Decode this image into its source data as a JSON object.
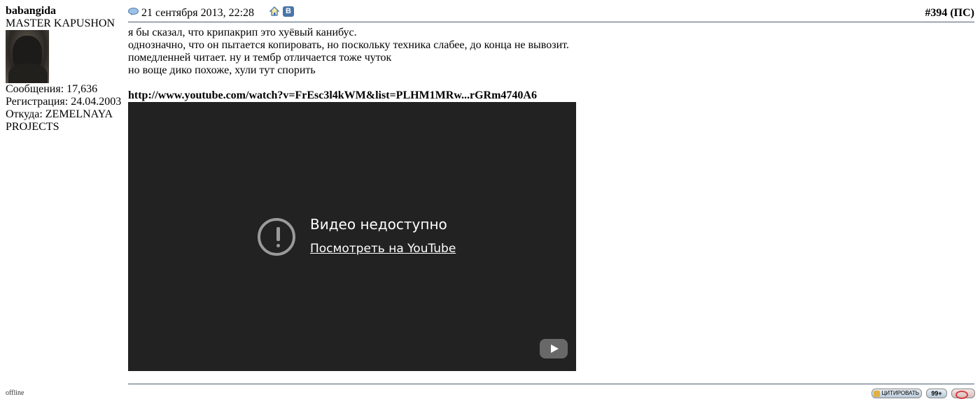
{
  "user": {
    "name": "babangida",
    "title": "MASTER KAPUSHON",
    "messages": "Сообщения: 17,636",
    "registered": "Регистрация: 24.04.2003",
    "location": "Откуда: ZEMELNAYA PROJECTS",
    "status": "offline"
  },
  "post": {
    "date": "21 сентября 2013, 22:28",
    "number": "#394 (ПС)",
    "vk_label": "В",
    "lines": [
      "я бы сказал, что крипакрип это хуёвый канибус.",
      "однозначно, что он пытается копировать, но поскольку техника слабее, до конца не вывозит.",
      "помедленней читает. ну и тембр отличается тоже чуток",
      "но вощe дико похоже, хули тут спорить"
    ],
    "link": "http://www.youtube.com/watch?v=FrEsc3l4kWM&list=PLHM1MRw...rGRm4740A6"
  },
  "video": {
    "title": "Видео недоступно",
    "watch_link": "Посмотреть на YouTube"
  },
  "footer": {
    "quote_label": "ЦИТИРОВАТЬ",
    "multi_label": "99+"
  },
  "icons": [
    "post-icon",
    "home-icon",
    "vk-icon",
    "warning-icon",
    "youtube-icon",
    "thanks-icon"
  ]
}
